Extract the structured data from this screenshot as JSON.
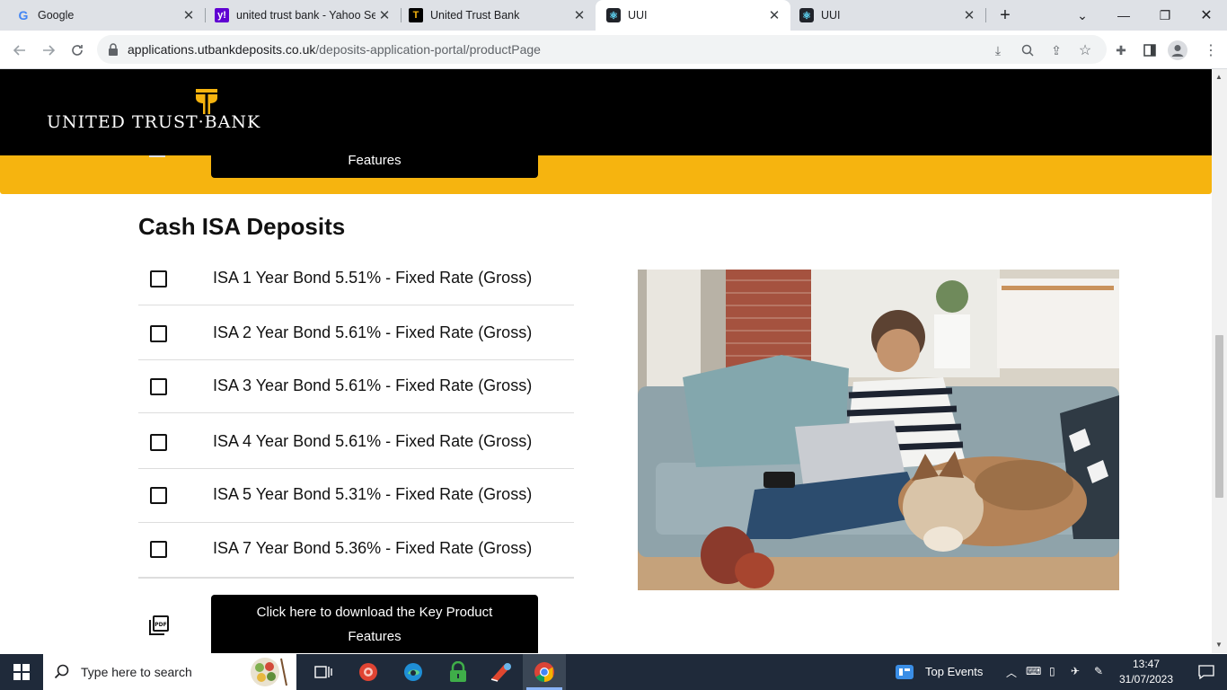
{
  "browser": {
    "tabs": [
      {
        "title": "Google",
        "favicon": "google-icon",
        "active": false
      },
      {
        "title": "united trust bank - Yahoo Sea",
        "favicon": "yahoo-icon",
        "active": false
      },
      {
        "title": "United Trust Bank",
        "favicon": "utb-icon",
        "active": false
      },
      {
        "title": "UUI",
        "favicon": "react-icon",
        "active": true
      },
      {
        "title": "UUI",
        "favicon": "react-icon",
        "active": false
      }
    ],
    "url_host": "applications.utbankdeposits.co.uk",
    "url_path": "/deposits-application-portal/productPage"
  },
  "header": {
    "logo_text": "UNITED TRUST·BANK"
  },
  "top_button_label": "Features",
  "section_title": "Cash ISA Deposits",
  "products": [
    {
      "label": "ISA 1 Year Bond 5.51% - Fixed Rate (Gross)",
      "checked": false
    },
    {
      "label": "ISA 2 Year Bond 5.61% - Fixed Rate (Gross)",
      "checked": false
    },
    {
      "label": "ISA 3 Year Bond 5.61% - Fixed Rate (Gross)",
      "checked": false
    },
    {
      "label": "ISA 4 Year Bond 5.61% - Fixed Rate (Gross)",
      "checked": false
    },
    {
      "label": "ISA 5 Year Bond 5.31% - Fixed Rate (Gross)",
      "checked": false
    },
    {
      "label": "ISA 7 Year Bond 5.36% - Fixed Rate (Gross)",
      "checked": false
    }
  ],
  "download_button": {
    "line1": "Click here to download the Key Product",
    "line2": "Features"
  },
  "taskbar": {
    "search_placeholder": "Type here to search",
    "top_events": "Top Events",
    "time": "13:47",
    "date": "31/07/2023"
  },
  "colors": {
    "brand_gold": "#f6b40f",
    "header_black": "#000000",
    "taskbar_bg": "#1f2a3a"
  }
}
